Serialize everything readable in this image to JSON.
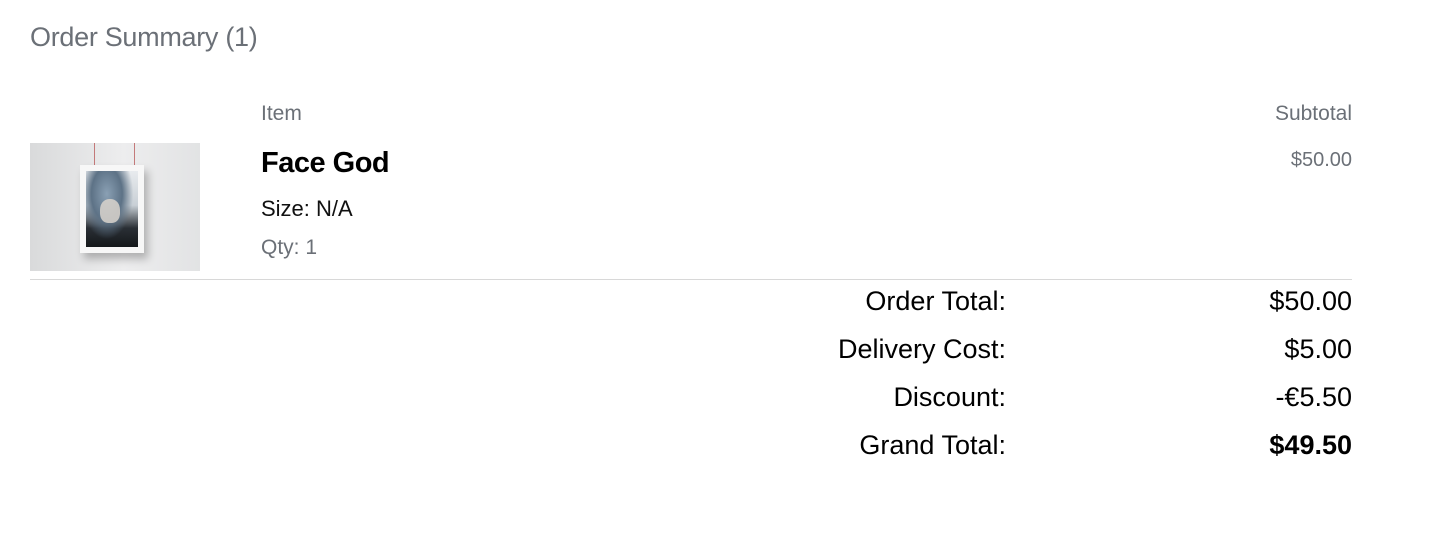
{
  "order_summary": {
    "title": "Order Summary (1)",
    "columns": {
      "item": "Item",
      "subtotal": "Subtotal"
    },
    "items": [
      {
        "name": "Face God",
        "size": "Size: N/A",
        "qty": "Qty: 1",
        "subtotal": "$50.00",
        "thumbnail_icon": "poster-artwork-image"
      }
    ],
    "totals": {
      "order_total_label": "Order Total:",
      "order_total_value": "$50.00",
      "delivery_cost_label": "Delivery Cost:",
      "delivery_cost_value": "$5.00",
      "discount_label": "Discount:",
      "discount_value": "-€5.50",
      "grand_total_label": "Grand Total:",
      "grand_total_value": "$49.50"
    }
  }
}
